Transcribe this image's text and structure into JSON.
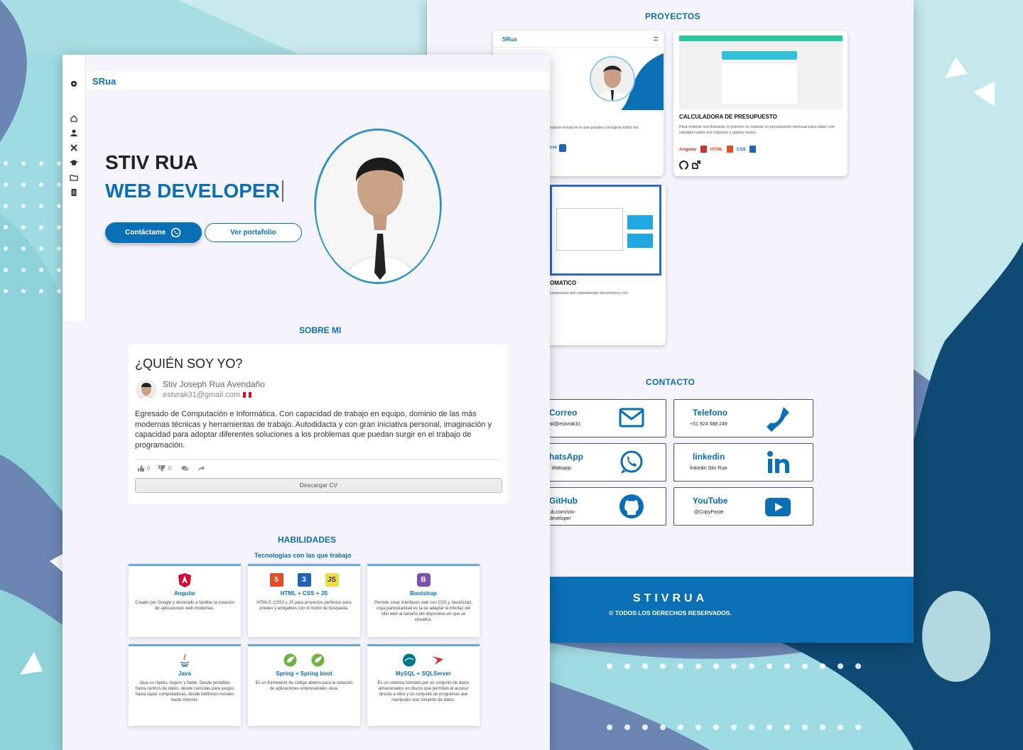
{
  "colors": {
    "brand": "#0b6fb5",
    "bg_light": "#9fdbe2",
    "bg_dark": "#0e4a73",
    "bg_mid": "#6c86b4",
    "page": "#f5f3fb"
  },
  "brand": {
    "logo": "SRua"
  },
  "hero": {
    "name": "STIV RUA",
    "role": "WEB DEVELOPER",
    "contact_button": "Contáctame",
    "portfolio_button": "Ver portafolio"
  },
  "sidebar": {
    "icons": [
      "gear-icon",
      "home-icon",
      "user-icon",
      "tools-icon",
      "graduation-cap-icon",
      "folder-icon",
      "document-icon"
    ]
  },
  "about": {
    "section_title": "SOBRE MI",
    "heading": "¿QUIÉN SOY YO?",
    "full_name": "Stiv Joseph Rua Avendaño",
    "email": "estvrak31@gmail.com",
    "bio": "Egresado de Computación e Informática. Con capacidad de trabajo en equipo, dominio de las más modernas técnicas y herramientas de trabajo. Autodidacta y con gran iniciativa personal, imaginación y capacidad para adoptar diferentes soluciones a los problemas que puedan surgir en el trabajo de programación.",
    "likes": "0",
    "dislikes": "0",
    "download_button": "Descargar CV"
  },
  "skills": {
    "section_title": "HABILIDADES",
    "subtitle": "Tecnologías con las que trabajo",
    "items": [
      {
        "name": "Angular",
        "desc": "Creado por Google y destinado a facilitar la creación de aplicaciones web modernas."
      },
      {
        "name": "HTML + CSS + JS",
        "desc": "HTML5, CSS3 y JS para proyectos perfectos para píxeles y amigables con el motor de búsqueda."
      },
      {
        "name": "Bootstrap",
        "desc": "Permite crear interfaces web con CSS y JavaScript, cuya particularidad es la de adaptar la interfaz del sitio web al tamaño del dispositivo en que se visualice."
      },
      {
        "name": "Java",
        "desc": "Java es rápido, seguro y fiable. Desde portátiles hasta centros de datos, desde consolas para juegos hasta súper computadoras, desde teléfonos móviles hasta Internet."
      },
      {
        "name": "Spring + Spring boot",
        "desc": "Es un framework de código abierto para la creación de aplicaciones empresariales Java."
      },
      {
        "name": "MySQL + SQLServer",
        "desc": "Es un sistema formado por un conjunto de datos almacenados en discos que permiten el acceso directo a ellos y un conjunto de programas que manipulen ese conjunto de datos."
      }
    ]
  },
  "projects": {
    "section_title": "PROYECTOS",
    "items": [
      {
        "title": "",
        "desc": "spacio virtual en el que puedes consignar todos los",
        "tags": [
          "css"
        ]
      },
      {
        "title": "CALCULADORA DE PRESUPUESTO",
        "desc": "Para ordenar sus finanzas, lo primero es realizar un presupuesto mensual para saber con claridad cuáles sus ingresos y gastos reales.",
        "tags": [
          "Angular",
          "HTML",
          "CSS"
        ]
      },
      {
        "title": "OMATICO",
        "desc": "compuesto por subsistemas electrónicos con",
        "tags": []
      }
    ]
  },
  "contact": {
    "section_title": "CONTACTO",
    "items": [
      {
        "label": "Correo",
        "value": "ail@estvrak31",
        "icon": "mail-icon"
      },
      {
        "label": "Telefono",
        "value": "+51 924 588 249",
        "icon": "phone-icon"
      },
      {
        "label": "hatsApp",
        "value": "i Watsapp",
        "icon": "whatsapp-icon"
      },
      {
        "label": "linkedin",
        "value": "linkedin Stiv Rua",
        "icon": "linkedin-icon"
      },
      {
        "label": "GitHub",
        "value": "ub.com/stiv-developer",
        "icon": "github-icon"
      },
      {
        "label": "YouTube",
        "value": "@CopyPaste",
        "icon": "youtube-icon"
      }
    ]
  },
  "footer": {
    "brand": "STIVRUA",
    "copyright": "© TODOS LOS DERECHOS RESERVADOS."
  }
}
